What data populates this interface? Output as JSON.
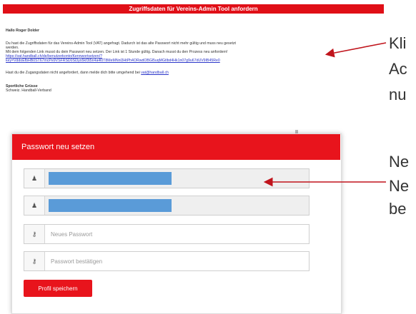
{
  "email": {
    "header": "Zugriffsdaten für Vereins-Admin Tool anfordern",
    "greeting": "Hallo Roger Dolder",
    "paragraph1_line1": "Du hast die Zugriffsdaten für das Vereins-Admin Tool (VAT) angefragt. Dadurch ist das alte Passwort nicht mehr gültig und muss neu gesetzt",
    "paragraph1_line2": "werden.",
    "paragraph1_line3": "Mit dem folgenden Link musst du dein Passwort neu setzen. Der Link ist 1 Stunde gültig. Danach musst du den Prozess neu anfordern!",
    "link_line1": "https://vat.handball.ch/de/benutzerkonto/Kennwortsetzen/?",
    "link_line2": "key=VddoEfbHB0ST67mcPe9VSFRSD0Sl3yo5kf3t5n4a4l0T8MeMNnl3HtPh4ORwdOBGl5uqMGtlbd4Hk1n07g9u67dUV9IB45Re0",
    "paragraph2_prefix": "Hast du die Zugangsdaten nicht angefordert, dann melde dich bitte umgehend bei",
    "paragraph2_email": "vat@handball.ch",
    "closing1": "Sportliche Grüsse",
    "closing2": "Schweiz. Handball-Verband"
  },
  "side": {
    "line1": "Kli",
    "line2": "Ac",
    "line3": "nu",
    "line4": "Ne",
    "line5": "Ne",
    "line6": "be"
  },
  "form": {
    "title": "Passwort neu setzen",
    "new_password_placeholder": "Neues Passwort",
    "confirm_password_placeholder": "Passwort bestätigen",
    "save_label": "Profil speichern",
    "user_icon_glyph": "♟",
    "key_icon_glyph": "⚷"
  },
  "colors": {
    "brand_red": "#e8141c",
    "redacted_blue": "#5a9bd8",
    "link_blue": "#2a35c9"
  }
}
